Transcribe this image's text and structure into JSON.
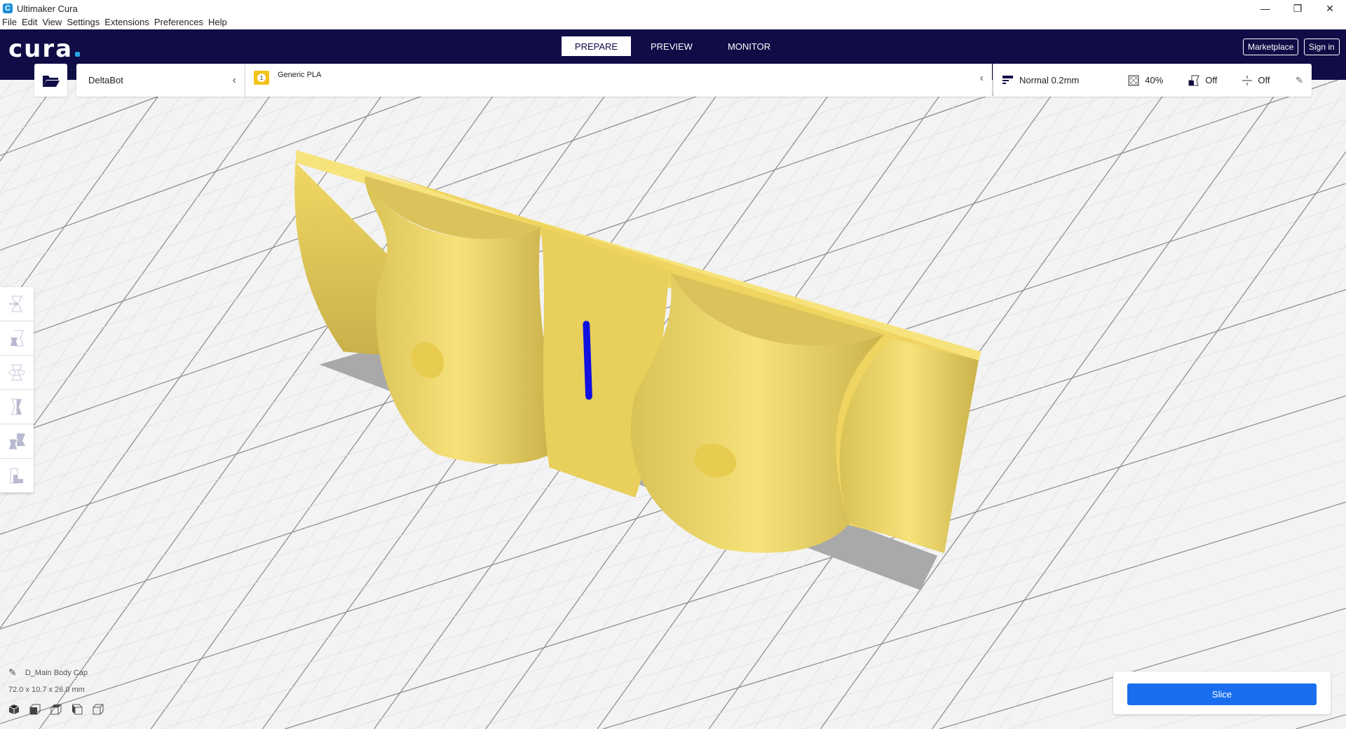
{
  "window": {
    "title": "Ultimaker Cura",
    "app_icon": "C"
  },
  "menu": [
    "File",
    "Edit",
    "View",
    "Settings",
    "Extensions",
    "Preferences",
    "Help"
  ],
  "navbar": {
    "logo": "cura",
    "tabs": [
      "PREPARE",
      "PREVIEW",
      "MONITOR"
    ],
    "active_tab": "PREPARE",
    "marketplace": "Marketplace",
    "sign_in": "Sign in"
  },
  "printer": {
    "name": "DeltaBot"
  },
  "material": {
    "badge": "1",
    "name": "Generic PLA",
    "badge_color": "#f3c318"
  },
  "print_settings": {
    "profile": "Normal 0.2mm",
    "infill": "40%",
    "support": "Off",
    "adhesion": "Off"
  },
  "object": {
    "name": "D_Main Body Cap",
    "dimensions": "72.0 x 10.7 x 26.0 mm"
  },
  "slice": {
    "label": "Slice"
  },
  "colors": {
    "navbar": "#0f0c46",
    "accent": "#196ef0",
    "model": "#f5dc5f"
  }
}
